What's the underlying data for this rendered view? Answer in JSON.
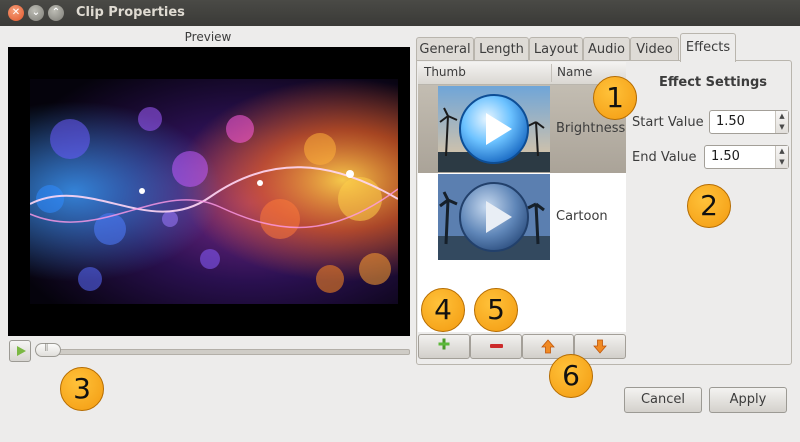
{
  "window": {
    "title": "Clip Properties"
  },
  "preview": {
    "label": "Preview"
  },
  "tabs": [
    "General",
    "Length",
    "Layout",
    "Audio",
    "Video",
    "Effects"
  ],
  "active_tab": "Effects",
  "effects_list": {
    "columns": [
      "Thumb",
      "Name"
    ],
    "rows": [
      {
        "name": "Brightness",
        "selected": true
      },
      {
        "name": "Cartoon",
        "selected": false
      }
    ]
  },
  "effect_settings": {
    "title": "Effect Settings",
    "start_label": "Start Value",
    "start_value": "1.50",
    "end_label": "End Value",
    "end_value": "1.50"
  },
  "callouts": [
    "1",
    "2",
    "3",
    "4",
    "5",
    "6"
  ],
  "buttons": {
    "cancel": "Cancel",
    "apply": "Apply"
  },
  "colors": {
    "callout": "#f7a21b",
    "title_bar": "#3f3f3b",
    "selected_row": "#b7b0a5"
  }
}
